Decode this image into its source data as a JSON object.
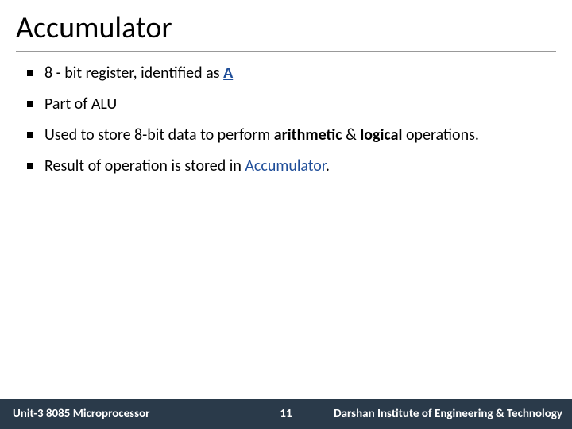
{
  "title": "Accumulator",
  "bullets": {
    "b1_pre": "8 - bit register, identified as ",
    "b1_a": "A",
    "b2": "Part of ALU",
    "b3_pre": "Used to store 8-bit data to perform ",
    "b3_arith": "arithmetic",
    "b3_amp": " & ",
    "b3_log": "logical",
    "b3_post": " operations.",
    "b4_pre": "Result of operation is stored in ",
    "b4_acc": "Accumulator",
    "b4_post": "."
  },
  "footer": {
    "left": "Unit-3 8085 Microprocessor",
    "page": "11",
    "right": "Darshan Institute of Engineering & Technology"
  }
}
